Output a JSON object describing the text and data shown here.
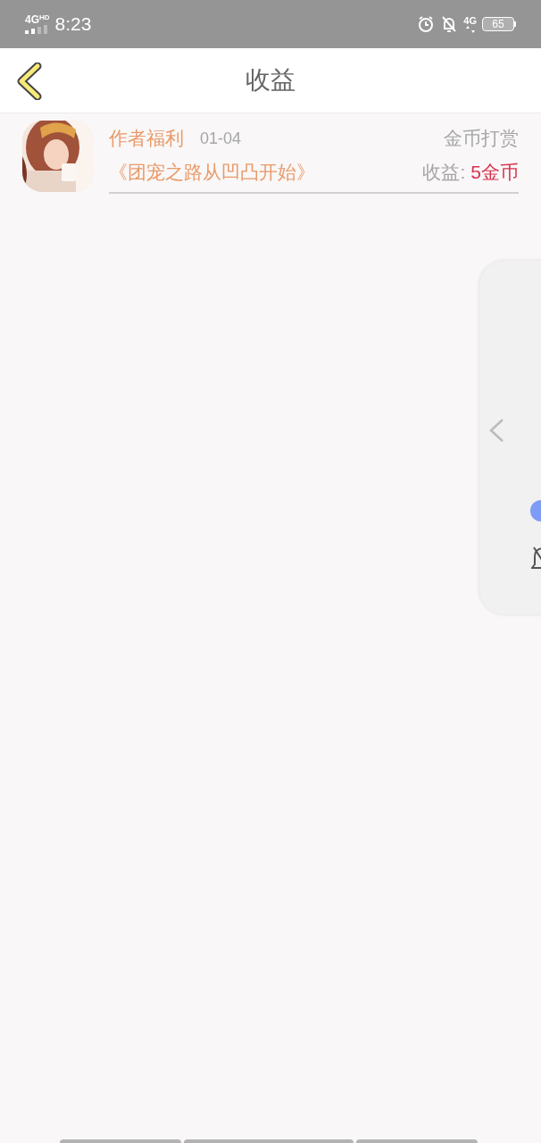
{
  "status_bar": {
    "network": "4G",
    "network_badge": "HD",
    "time": "8:23",
    "data_label": "4G",
    "battery": "65"
  },
  "header": {
    "title": "收益"
  },
  "records": [
    {
      "kind": "picture",
      "label": "作者福利",
      "date": "01-04",
      "type": "金币打赏",
      "book": "《团宠之路从凹凸开始》",
      "income_label": "收益:",
      "income_value": "5金币"
    }
  ]
}
